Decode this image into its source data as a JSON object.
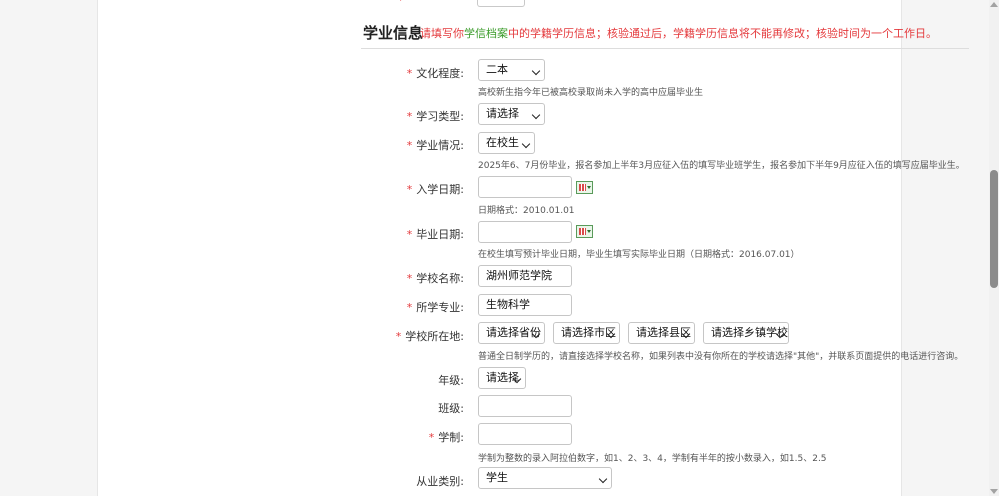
{
  "section": {
    "title": "学业信息",
    "notice_before": "请填写你",
    "notice_link": "学信档案",
    "notice_after": "中的学籍学历信息；核验通过后，学籍学历信息将不能再修改；核验时间为一个工作日。"
  },
  "fields": {
    "education_level": {
      "label": "文化程度:",
      "value": "二本",
      "hint": "高校新生指今年已被高校录取尚未入学的高中应届毕业生"
    },
    "study_type": {
      "label": "学习类型:",
      "value": "请选择"
    },
    "study_status": {
      "label": "学业情况:",
      "value": "在校生",
      "hint": "2025年6、7月份毕业，报名参加上半年3月应征入伍的填写毕业班学生，报名参加下半年9月应征入伍的填写应届毕业生。"
    },
    "enroll_date": {
      "label": "入学日期:",
      "value": "",
      "hint": "日期格式：2010.01.01"
    },
    "graduate_date": {
      "label": "毕业日期:",
      "value": "",
      "hint": "在校生填写预计毕业日期，毕业生填写实际毕业日期（日期格式：2016.07.01）"
    },
    "school_name": {
      "label": "学校名称:",
      "value": "湖州师范学院"
    },
    "major": {
      "label": "所学专业:",
      "value": "生物科学"
    },
    "school_location": {
      "label": "学校所在地:",
      "province": "请选择省份",
      "city": "请选择市区",
      "county": "请选择县区",
      "town": "请选择乡镇学校",
      "hint": "普通全日制学历的，请直接选择学校名称，如果列表中没有你所在的学校请选择\"其他\"，并联系页面提供的电话进行咨询。"
    },
    "grade": {
      "label": "年级:",
      "value": "请选择"
    },
    "class_no": {
      "label": "班级:",
      "value": ""
    },
    "school_system": {
      "label": "学制:",
      "value": "",
      "hint": "学制为整数的录入阿拉伯数字，如1、2、3、4，学制有半年的按小数录入，如1.5、2.5"
    },
    "occupation": {
      "label": "从业类别:",
      "value": "学生"
    }
  },
  "colors": {
    "required_star": "#e4393c",
    "notice": "#e4393c",
    "notice_link": "#3a9b2a"
  }
}
